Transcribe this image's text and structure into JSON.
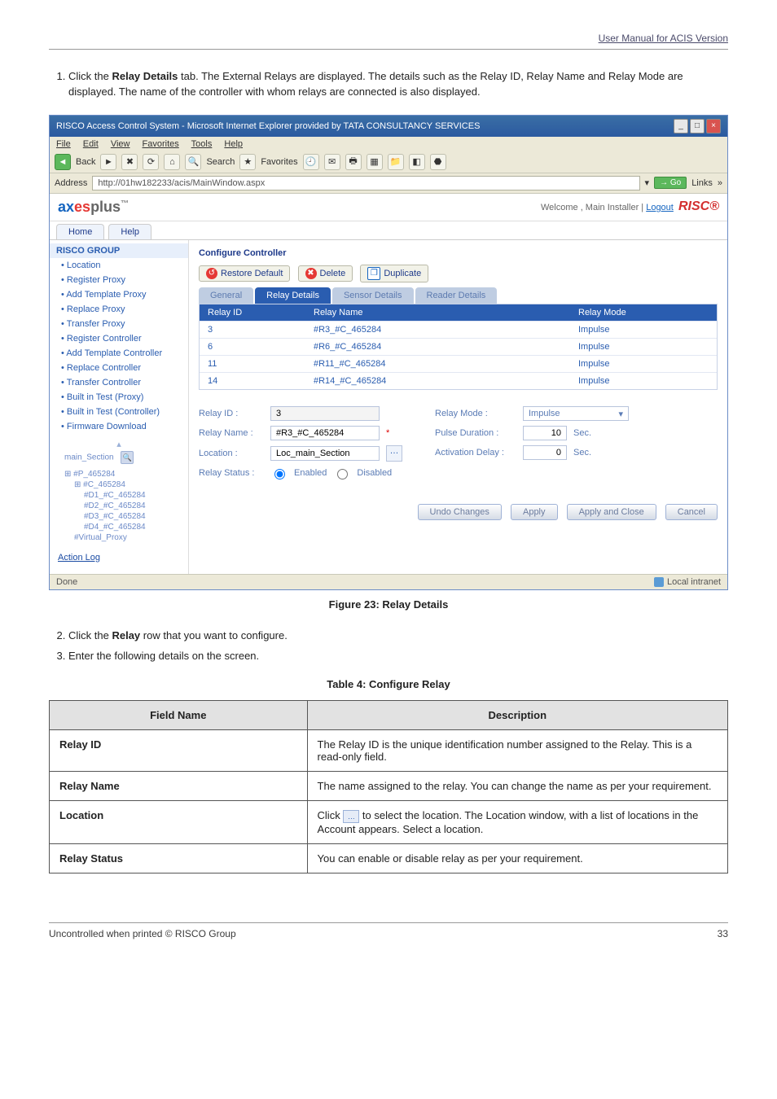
{
  "header": {
    "text": "User Manual for ACIS Version"
  },
  "steps_top": [
    {
      "n": "1.",
      "pre": "Click the ",
      "bold": "Relay Details",
      "post": " tab. The External Relays are displayed. The details such as the Relay ID, Relay Name and Relay Mode are displayed. The name of the controller with whom relays are connected is also displayed."
    }
  ],
  "shot": {
    "title": "RISCO Access Control System - Microsoft Internet Explorer provided by TATA CONSULTANCY SERVICES",
    "menus": [
      "File",
      "Edit",
      "View",
      "Favorites",
      "Tools",
      "Help"
    ],
    "back": "Back",
    "search": "Search",
    "favorites": "Favorites",
    "addr_label": "Address",
    "addr_value": "http://01hw182233/acis/MainWindow.aspx",
    "go": "Go",
    "links": "Links",
    "logo_ax": "ax",
    "logo_es": "es",
    "logo_plus": "plus",
    "logo_tm": "™",
    "welcome_pre": "Welcome ,  Main Installer  |  ",
    "welcome_logout": "Logout",
    "welcome_brand": "RISC®",
    "tabs": [
      "Home",
      "Help"
    ],
    "side_group": "RISCO GROUP",
    "side_items_top": [
      "Location",
      "Register Proxy",
      "Add Template Proxy",
      "Replace Proxy",
      "Transfer Proxy",
      "Register Controller",
      "Add Template Controller",
      "Replace Controller",
      "Transfer Controller",
      "Built in Test (Proxy)",
      "Built in Test (Controller)",
      "Firmware Download"
    ],
    "side_section_label": "main_Section",
    "tree": {
      "root": "#P_465284",
      "c": "#C_465284",
      "leaves": [
        "#D1_#C_465284",
        "#D2_#C_465284",
        "#D3_#C_465284",
        "#D4_#C_465284"
      ],
      "virtual": "#Virtual_Proxy"
    },
    "action_log": "Action Log",
    "section_title": "Configure Controller",
    "tool_restore": "Restore Default",
    "tool_delete": "Delete",
    "tool_dup": "Duplicate",
    "subtabs": [
      "General",
      "Relay Details",
      "Sensor Details",
      "Reader Details"
    ],
    "grid_headers": [
      "Relay ID",
      "Relay Name",
      "Relay Mode"
    ],
    "grid_rows": [
      {
        "id": "3",
        "name": "#R3_#C_465284",
        "mode": "Impulse"
      },
      {
        "id": "6",
        "name": "#R6_#C_465284",
        "mode": "Impulse"
      },
      {
        "id": "11",
        "name": "#R11_#C_465284",
        "mode": "Impulse"
      },
      {
        "id": "14",
        "name": "#R14_#C_465284",
        "mode": "Impulse"
      }
    ],
    "form": {
      "relay_id_label": "Relay ID :",
      "relay_id_val": "3",
      "relay_name_label": "Relay Name :",
      "relay_name_val": "#R3_#C_465284",
      "location_label": "Location :",
      "location_val": "Loc_main_Section",
      "relay_status_label": "Relay Status :",
      "status_en": "Enabled",
      "status_dis": "Disabled",
      "relay_mode_label": "Relay Mode :",
      "relay_mode_val": "Impulse",
      "pulse_label": "Pulse Duration :",
      "pulse_val": "10",
      "pulse_unit": "Sec.",
      "act_label": "Activation Delay :",
      "act_val": "0",
      "act_unit": "Sec."
    },
    "btn_undo": "Undo Changes",
    "btn_apply": "Apply",
    "btn_apply_close": "Apply and Close",
    "btn_cancel": "Cancel",
    "status_done": "Done",
    "status_intranet": "Local intranet"
  },
  "fig_caption": "Figure 23: Relay Details",
  "steps_mid": [
    {
      "n": "2.",
      "pre": "Click the ",
      "bold": "Relay",
      "post": " row that you want to configure."
    },
    {
      "n": "3.",
      "pre": "Enter the following details on the screen.",
      "bold": "",
      "post": ""
    }
  ],
  "table_caption": "Table 4: Configure Relay",
  "table": {
    "h1": "Field Name",
    "h2": "Description",
    "rows": [
      {
        "f": "Relay ID",
        "d": "The Relay ID is the unique identification number assigned to the Relay. This is a read-only field."
      },
      {
        "f": "Relay Name",
        "d": "The name assigned to the relay. You can change the name as per your requirement."
      },
      {
        "f": "Location",
        "icon_pre": "Click ",
        "icon": "…",
        "icon_post": " to select the location. The Location window, with a list of locations in the Account appears. Select a location."
      },
      {
        "f": "Relay Status",
        "d": "You can enable or disable relay as per your requirement."
      }
    ]
  },
  "footer": {
    "left": "Uncontrolled when printed © RISCO Group",
    "right": "33"
  }
}
